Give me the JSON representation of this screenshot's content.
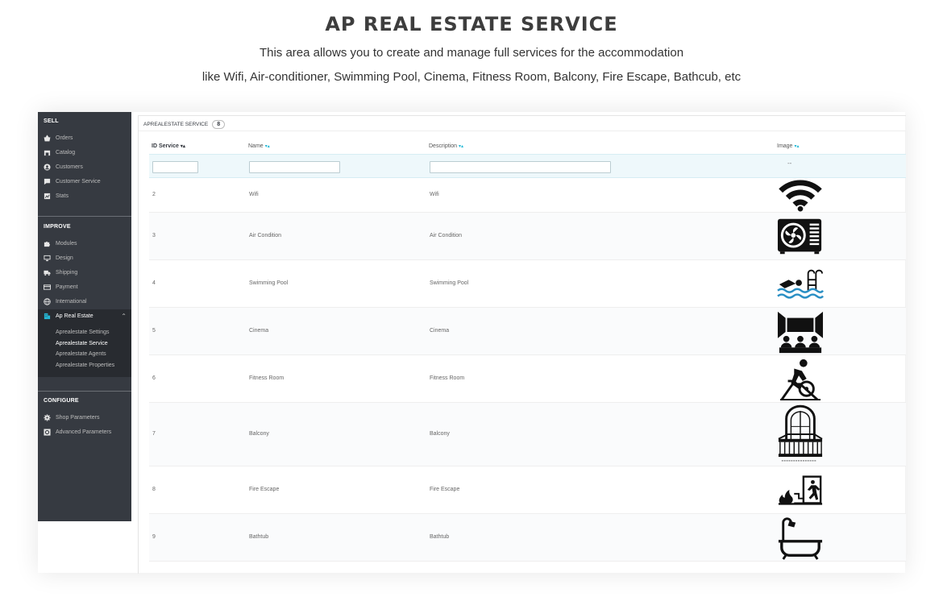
{
  "header": {
    "title": "AP REAL ESTATE SERVICE",
    "line1": "This area allows you to create and manage full services for the accommodation",
    "line2": "like Wifi, Air-conditioner, Swimming Pool, Cinema, Fitness Room, Balcony, Fire Escape, Bathcub, etc"
  },
  "sidebar": {
    "sell": {
      "label": "SELL",
      "items": [
        {
          "label": "Orders",
          "icon": "basket-icon"
        },
        {
          "label": "Catalog",
          "icon": "store-icon"
        },
        {
          "label": "Customers",
          "icon": "user-icon"
        },
        {
          "label": "Customer Service",
          "icon": "chat-icon"
        },
        {
          "label": "Stats",
          "icon": "stats-icon"
        }
      ]
    },
    "improve": {
      "label": "IMPROVE",
      "items": [
        {
          "label": "Modules",
          "icon": "puzzle-icon"
        },
        {
          "label": "Design",
          "icon": "monitor-icon"
        },
        {
          "label": "Shipping",
          "icon": "truck-icon"
        },
        {
          "label": "Payment",
          "icon": "card-icon"
        },
        {
          "label": "International",
          "icon": "globe-icon"
        },
        {
          "label": "Ap Real Estate",
          "icon": "building-icon"
        }
      ],
      "subitems": [
        "Aprealestate Settings",
        "Aprealestate Service",
        "Aprealestate Agents",
        "Aprealestate Properties"
      ]
    },
    "configure": {
      "label": "CONFIGURE",
      "items": [
        {
          "label": "Shop Parameters",
          "icon": "gear-icon"
        },
        {
          "label": "Advanced Parameters",
          "icon": "cog-box-icon"
        }
      ]
    }
  },
  "panel": {
    "title": "APREALESTATE SERVICE",
    "count": "8"
  },
  "table": {
    "columns": [
      "ID Service",
      "Name",
      "Description",
      "Image"
    ],
    "filter_dash": "--",
    "rows": [
      {
        "id": "2",
        "name": "Wifi",
        "description": "Wifi",
        "image_icon": "wifi-icon"
      },
      {
        "id": "3",
        "name": "Air Condition",
        "description": "Air Condition",
        "image_icon": "air-conditioner-icon"
      },
      {
        "id": "4",
        "name": "Swimming Pool",
        "description": "Swimming Pool",
        "image_icon": "swimming-pool-icon"
      },
      {
        "id": "5",
        "name": "Cinema",
        "description": "Cinema",
        "image_icon": "cinema-icon"
      },
      {
        "id": "6",
        "name": "Fitness Room",
        "description": "Fitness Room",
        "image_icon": "fitness-bike-icon"
      },
      {
        "id": "7",
        "name": "Balcony",
        "description": "Balcony",
        "image_icon": "balcony-icon"
      },
      {
        "id": "8",
        "name": "Fire Escape",
        "description": "Fire Escape",
        "image_icon": "fire-escape-icon"
      },
      {
        "id": "9",
        "name": "Bathtub",
        "description": "Bathtub",
        "image_icon": "bathtub-icon"
      }
    ]
  },
  "colors": {
    "sidebar_bg": "#363a41",
    "accent": "#25b9d7",
    "filter_bg": "#eef8fb"
  }
}
